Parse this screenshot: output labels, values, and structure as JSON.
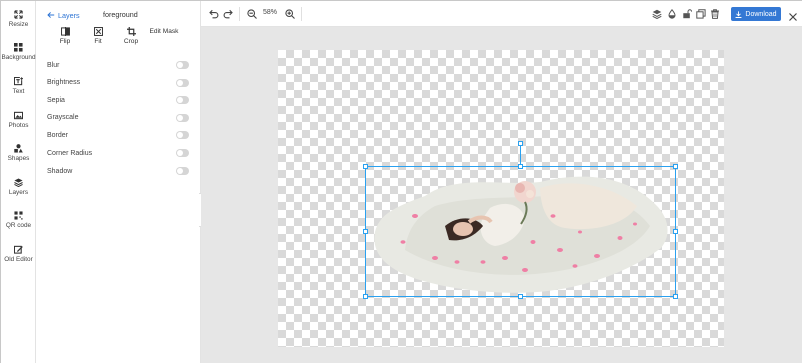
{
  "rail": {
    "items": [
      {
        "label": "Resize",
        "icon": "resize-icon"
      },
      {
        "label": "Background",
        "icon": "background-icon"
      },
      {
        "label": "Text",
        "icon": "text-icon"
      },
      {
        "label": "Photos",
        "icon": "photos-icon"
      },
      {
        "label": "Shapes",
        "icon": "shapes-icon"
      },
      {
        "label": "Layers",
        "icon": "layers-icon"
      },
      {
        "label": "QR code",
        "icon": "qr-code-icon"
      },
      {
        "label": "Old Editor",
        "icon": "old-editor-icon"
      }
    ]
  },
  "panel": {
    "back_label": "Layers",
    "current_layer": "foreground",
    "tools": [
      {
        "label": "Flip",
        "icon": "flip-icon"
      },
      {
        "label": "Fit",
        "icon": "fit-icon"
      },
      {
        "label": "Crop",
        "icon": "crop-icon"
      },
      {
        "label": "Edit Mask",
        "icon": "edit-mask-icon"
      }
    ],
    "toggles": [
      {
        "label": "Blur",
        "on": false
      },
      {
        "label": "Brightness",
        "on": false
      },
      {
        "label": "Sepia",
        "on": false
      },
      {
        "label": "Grayscale",
        "on": false
      },
      {
        "label": "Border",
        "on": false
      },
      {
        "label": "Corner Radius",
        "on": false
      },
      {
        "label": "Shadow",
        "on": false
      }
    ]
  },
  "toolbar": {
    "zoom_level": "58%",
    "download_label": "Download",
    "icons": [
      "undo-icon",
      "redo-icon",
      "zoom-out-icon",
      "zoom-in-icon",
      "layer-stack-icon",
      "opacity-icon",
      "lock-icon",
      "duplicate-icon",
      "delete-icon",
      "close-icon"
    ]
  },
  "colors": {
    "accent": "#3478d4",
    "selection": "#2aa1f0",
    "workspace_bg": "#e6e6e6",
    "checker": "#d9d9d9"
  }
}
